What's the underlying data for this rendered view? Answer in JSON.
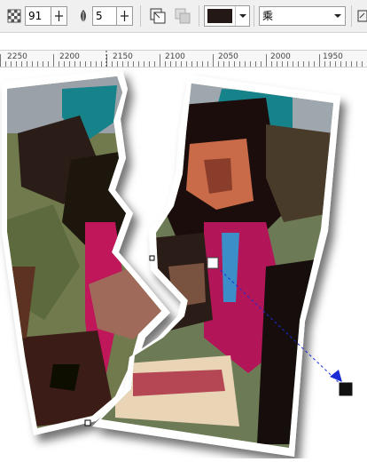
{
  "toolbar": {
    "transparency_value": "91",
    "feather_value": "5",
    "merge_mode": "乘",
    "fill_color": "#231815",
    "icons": [
      "transparency-icon",
      "feather-icon",
      "freeze-icon",
      "copy-properties-icon",
      "color-swatch-icon",
      "merge-mode-dropdown",
      "edit-icon"
    ]
  },
  "ruler": {
    "labels": [
      "2250",
      "2200",
      "2150",
      "2100",
      "2050",
      "2000",
      "1950"
    ]
  },
  "canvas": {
    "artwork": "torn-photo-illustration",
    "handle_color": "#000000",
    "transparency_line_color": "#1a2bd6"
  }
}
